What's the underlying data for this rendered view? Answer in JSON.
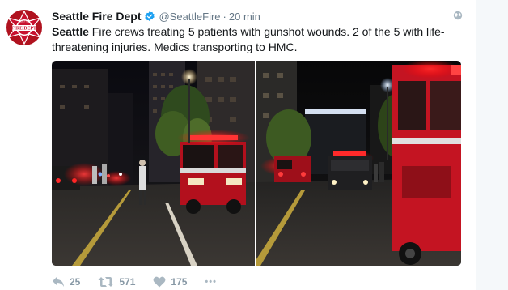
{
  "tweet": {
    "display_name": "Seattle Fire Dept",
    "handle": "@SeattleFire",
    "separator": "·",
    "time": "20 min",
    "text_lead": "Seattle",
    "text_rest": " Fire crews treating 5 patients with gunshot wounds. 2 of the 5 with life-threatening injuries. Medics transporting to HMC.",
    "avatar_text_top": "FIRE DEPT.",
    "avatar_text_bottom": "SEATTLE",
    "icons": {
      "verified": "verified-badge-icon",
      "globe": "globe-icon",
      "reply": "reply-icon",
      "retweet": "retweet-icon",
      "like": "heart-icon",
      "more": "more-icon"
    }
  },
  "actions": {
    "reply_count": "25",
    "retweet_count": "571",
    "like_count": "175",
    "more_label": "•••"
  },
  "colors": {
    "brand_red": "#c8102e",
    "verified_blue": "#1da1f2",
    "action_gray": "#aab8c2"
  }
}
